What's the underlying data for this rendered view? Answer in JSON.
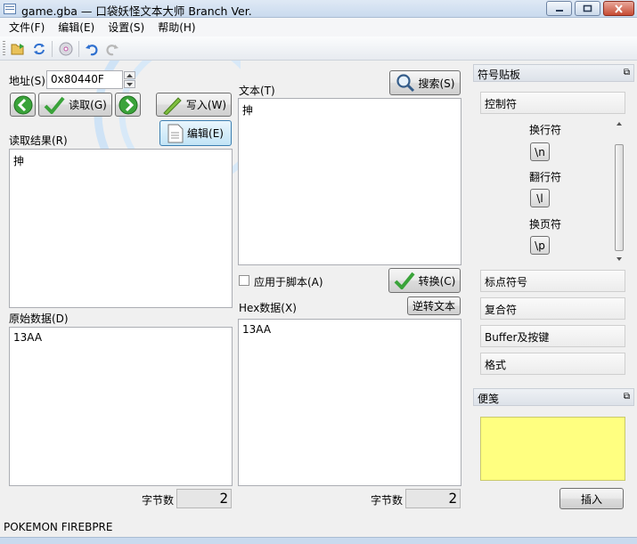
{
  "window": {
    "title": "game.gba — 口袋妖怪文本大师 Branch Ver."
  },
  "menu": [
    "文件(F)",
    "编辑(E)",
    "设置(S)",
    "帮助(H)"
  ],
  "address": {
    "label": "地址(S)",
    "value": "0x80440F"
  },
  "buttons": {
    "read": "读取(G)",
    "write": "写入(W)",
    "edit": "编辑(E)",
    "search": "搜索(S)",
    "convert": "转换(C)",
    "reverse": "逆转文本",
    "insert": "插入"
  },
  "labels": {
    "read_result": "读取结果(R)",
    "text": "文本(T)",
    "raw_data": "原始数据(D)",
    "hex_data": "Hex数据(X)",
    "apply_script": "应用于脚本(A)",
    "byte_count": "字节数"
  },
  "values": {
    "read_result": "抻",
    "text": "抻",
    "raw_data": "13AA",
    "hex_data": "13AA",
    "byte_count_left": "2",
    "byte_count_right": "2"
  },
  "symbol_panel": {
    "title": "符号贴板",
    "categories": [
      "控制符",
      "标点符号",
      "复合符",
      "Buffer及按键",
      "格式"
    ],
    "symbols": [
      {
        "name": "换行符",
        "code": "\\n"
      },
      {
        "name": "翻行符",
        "code": "\\l"
      },
      {
        "name": "换页符",
        "code": "\\p"
      }
    ]
  },
  "note_panel": {
    "title": "便笺",
    "color": "#ffff80"
  },
  "status": "POKEMON FIREBPRE"
}
